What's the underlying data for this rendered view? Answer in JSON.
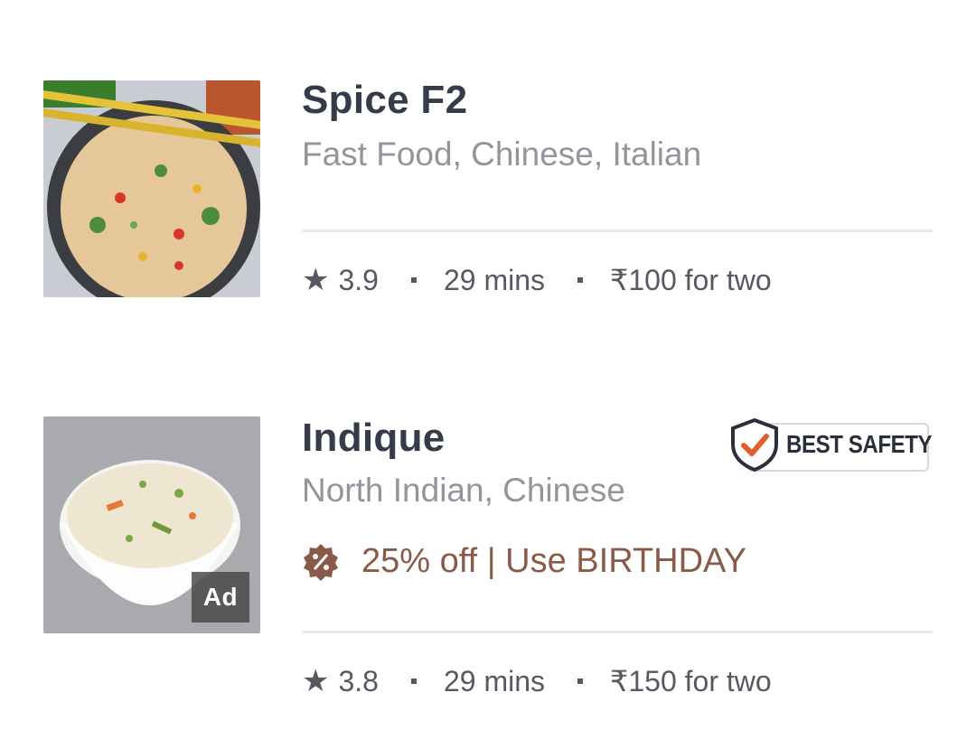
{
  "restaurants": [
    {
      "name": "Spice F2",
      "cuisines": "Fast Food, Chinese, Italian",
      "rating": "3.9",
      "delivery_time": "29 mins",
      "price": "₹100 for two"
    },
    {
      "name": "Indique",
      "cuisines": "North Indian, Chinese",
      "offer": "25% off | Use BIRTHDAY",
      "badge": "BEST SAFETY",
      "ad_label": "Ad",
      "rating": "3.8",
      "delivery_time": "29 mins",
      "price": "₹150 for two"
    }
  ],
  "icons": {
    "rating": "star-icon",
    "offer": "discount-badge-icon",
    "safety": "shield-check-icon"
  },
  "colors": {
    "name": "#363b4a",
    "cuisines": "#94959c",
    "meta": "#565961",
    "offer": "#8a5a48",
    "safety_check": "#e05f2b"
  }
}
